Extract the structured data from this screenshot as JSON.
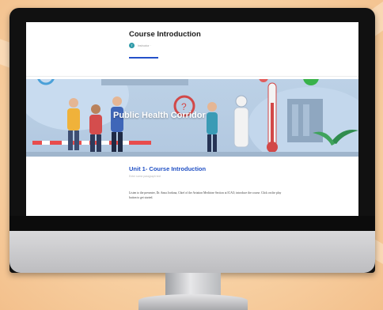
{
  "page": {
    "course_title": "Course Introduction",
    "author_initial": "T",
    "author_meta": "Instructor  ·",
    "banner_title": "Public Health Corridor",
    "unit_title": "Unit 1- Course Introduction",
    "unit_subtitle": "Enter some paragraph text",
    "body_text": "Listen to the presenter, Dr. Anna Jordana, Chief of the Aviation Medicine Section at ICAO, introduce the course. Click on the play button to get started."
  },
  "colors": {
    "accent_blue": "#1f4fc4",
    "avatar_teal": "#2e9aa8",
    "background_peach": "#f6d3a6"
  }
}
